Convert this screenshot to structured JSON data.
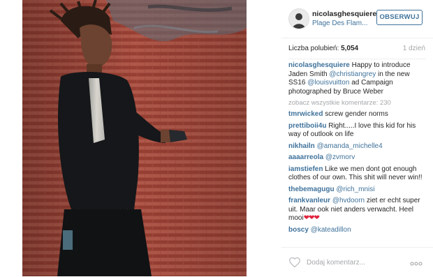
{
  "post": {
    "username": "nicolasghesquiere",
    "location": "Plage Des Flam...",
    "follow_label": "OBSERWUJ",
    "likes_label": "Liczba polubień:",
    "likes_count": "5,054",
    "time_ago": "1 dzień",
    "caption": {
      "user": "nicolasghesquiere",
      "parts": [
        "Happy to introduce Jaden Smith ",
        "@christiangrey",
        " in the new SS16 ",
        "@louisvuitton",
        " ad Campaign photographed by Bruce Weber"
      ]
    },
    "view_all_comments": "zobacz wszystkie komentarze: 230",
    "comments": [
      {
        "user": "tmrwicked",
        "text": "screw gender norms",
        "mention": ""
      },
      {
        "user": "prettiboii4u",
        "text": "Right.....I love this kid for his way of outlook on life",
        "mention": ""
      },
      {
        "user": "nikhailn",
        "text": "",
        "mention": "@amanda_michelle4"
      },
      {
        "user": "aaaarreola",
        "text": "",
        "mention": "@zvmorv"
      },
      {
        "user": "iamstiefen",
        "text": "Like we men dont got enough clothes of our own. This shit will never win!!",
        "mention": ""
      },
      {
        "user": "thebemagugu",
        "text": "",
        "mention": "@rich_mnisi"
      },
      {
        "user": "frankvanleur",
        "text": " ziet er echt super uit. Maar ook niet anders verwacht. Heel mooi",
        "mention": "@hvdoorn",
        "hearts": "❤❤❤"
      },
      {
        "user": "boscy",
        "text": "",
        "mention": "@kateadillon"
      }
    ],
    "add_comment_placeholder": "Dodaj komentarz..."
  },
  "icons": {
    "like": "heart-outline-icon",
    "options": "more-dots-icon",
    "avatar": "user-avatar"
  },
  "colors": {
    "link": "#3f729b",
    "muted": "#a5a7aa",
    "text": "#262626",
    "heart": "#e0233c"
  }
}
